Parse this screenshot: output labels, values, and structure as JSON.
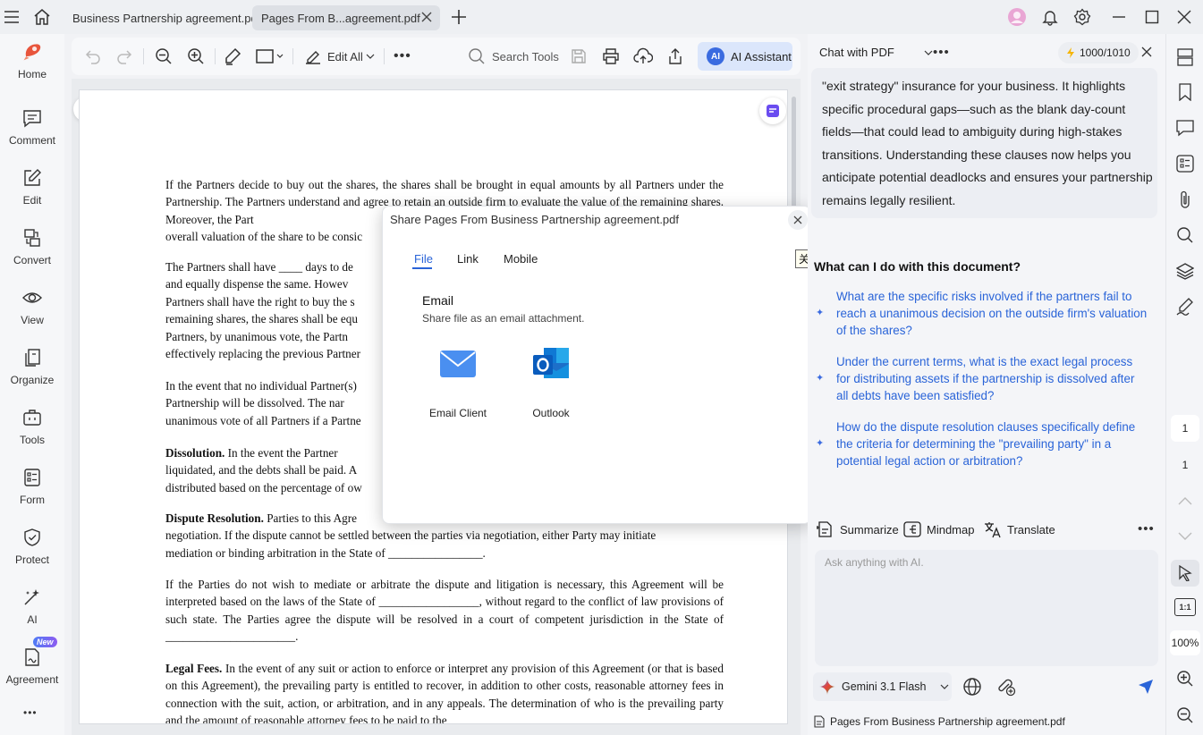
{
  "titlebar": {
    "tabs": [
      {
        "label": "Business Partnership agreement.pdf"
      },
      {
        "label": "Pages From B...agreement.pdf"
      }
    ]
  },
  "leftnav": {
    "items": [
      {
        "label": "Home",
        "icon": "home-logo-icon"
      },
      {
        "label": "Comment",
        "icon": "comment-icon"
      },
      {
        "label": "Edit",
        "icon": "edit-icon"
      },
      {
        "label": "Convert",
        "icon": "convert-icon"
      },
      {
        "label": "View",
        "icon": "view-icon"
      },
      {
        "label": "Organize",
        "icon": "organize-icon"
      },
      {
        "label": "Tools",
        "icon": "tools-icon"
      },
      {
        "label": "Form",
        "icon": "form-icon"
      },
      {
        "label": "Protect",
        "icon": "protect-icon"
      },
      {
        "label": "AI",
        "icon": "ai-icon"
      },
      {
        "label": "Agreement",
        "icon": "agreement-icon"
      }
    ],
    "new_badge": "New",
    "more": "•••"
  },
  "toolbar": {
    "edit_all": "Edit All",
    "search_tools": "Search Tools",
    "ai_assistant": "AI Assistant",
    "ai_badge": "AI"
  },
  "document": {
    "p1": "If the Partners decide to buy out the shares, the shares shall be brought in equal amounts by all Partners under the Partnership. The Partners understand and agree to retain an outside firm to evaluate the value of the remaining shares. Moreover, the Part",
    "p1_end": "overall valuation of the share to be consic",
    "p2": "The Partners shall have ____ days to de",
    "p2_l2": "and equally dispense the same. Howev",
    "p2_l3": "Partners shall have the right to buy the s",
    "p2_l4": "remaining shares, the shares shall be equ",
    "p2_l5": "Partners, by unanimous vote, the Partn",
    "p2_l6": "effectively replacing the previous Partner",
    "p3_l1": "In the event that no individual Partner(s)",
    "p3_l2": "Partnership will be dissolved. The nar",
    "p3_l3": "unanimous vote of all Partners if a Partne",
    "p4_head": "Dissolution.",
    "p4_l1": " In the event the Partner",
    "p4_l2": "liquidated, and the debts shall be paid. A",
    "p4_l3": "distributed based on the percentage of ow",
    "p5_head": "Dispute Resolution.",
    "p5_l1": " Parties to this Agre",
    "p5_l2": "negotiation. If the dispute cannot be settled between the parties via negotiation, either Party may initiate",
    "p5_l3": "mediation or binding arbitration in the State of ________________.",
    "p6": "If the Parties do not wish to mediate or arbitrate the dispute and litigation is necessary, this Agreement will be interpreted based on the laws of the State of _________________, without regard to the conflict of law provisions of such state. The Parties agree the dispute will be resolved in a court of competent jurisdiction in the State of ______________________.",
    "p7_head": "Legal Fees.",
    "p7": " In the event of any suit or action to enforce or interpret any provision of this Agreement (or that is based on this Agreement), the prevailing party is entitled to recover, in addition to other costs, reasonable attorney fees in connection with the suit, action, or arbitration, and in any appeals. The determination of who is the prevailing party and the amount of reasonable attorney fees to be paid to the"
  },
  "dialog": {
    "title": "Share Pages From Business Partnership agreement.pdf",
    "tabs": [
      "File",
      "Link",
      "Mobile"
    ],
    "section_title": "Email",
    "section_desc": "Share file as an email attachment.",
    "options": [
      {
        "label": "Email Client",
        "icon": "email-client-icon"
      },
      {
        "label": "Outlook",
        "icon": "outlook-icon"
      }
    ],
    "close_tooltip": "关闭"
  },
  "chat": {
    "mode": "Chat with PDF",
    "credits": "1000/1010",
    "answer": "\"exit strategy\" insurance for your business. It highlights specific procedural gaps—such as the blank day-count fields—that could lead to ambiguity during high-stakes transitions. Understanding these clauses now helps you anticipate potential deadlocks and ensures your partnership remains legally resilient.",
    "question_heading": "What can I do with this document?",
    "suggestions": [
      "What are the specific risks involved if the partners fail to reach a unanimous decision on the outside firm's valuation of the shares?",
      "Under the current terms, what is the exact legal process for distributing assets if the partnership is dissolved after all debts have been satisfied?",
      "How do the dispute resolution clauses specifically define the criteria for determining the \"prevailing party\" in a potential legal action or arbitration?"
    ],
    "actions": {
      "summarize": "Summarize",
      "mindmap": "Mindmap",
      "translate": "Translate"
    },
    "input_placeholder": "Ask anything with AI.",
    "model": "Gemini 3.1 Flash",
    "file_name": "Pages From Business Partnership agreement.pdf"
  },
  "rightrail": {
    "page_current": "1",
    "page_total": "1",
    "zoom": "100%",
    "fit_label": "1:1"
  },
  "colors": {
    "accent": "#2a64d8",
    "ai_bg": "#dbe6fb",
    "logo": "#e8553c"
  }
}
